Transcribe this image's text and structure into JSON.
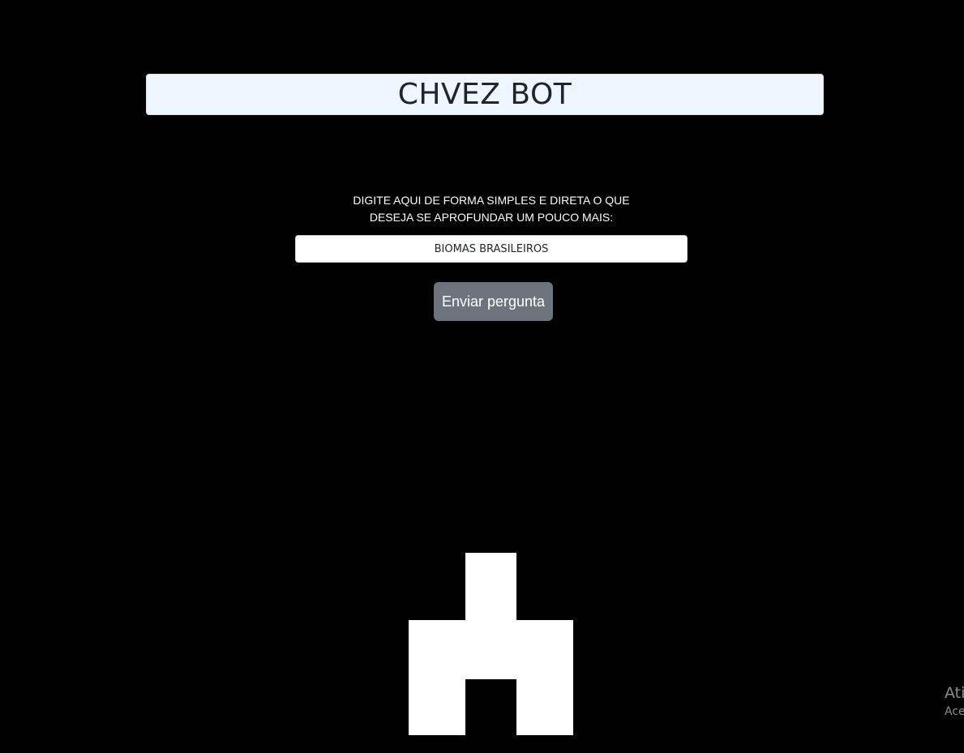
{
  "header": {
    "title": "CHVEZ BOT"
  },
  "prompt": {
    "line1": "DIGITE AQUI DE FORMA SIMPLES E DIRETA O QUE",
    "line2": "DESEJA SE APROFUNDAR UM POUCO MAIS:"
  },
  "query": {
    "value": "BIOMAS BRASILEIROS"
  },
  "actions": {
    "send_label": "Enviar pergunta"
  },
  "robot": {
    "icon": "robot-silhouette-icon",
    "color": "#ffffff"
  },
  "watermark": {
    "line1": "Ati",
    "line2": "Ace"
  },
  "colors": {
    "background": "#000000",
    "header_bg": "#eef6ff",
    "button_bg": "#6c757d"
  }
}
